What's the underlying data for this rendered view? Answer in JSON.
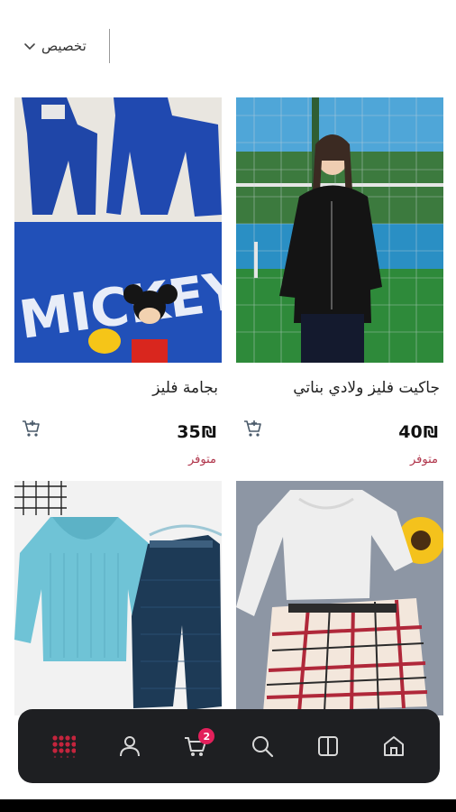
{
  "filter": {
    "label": "تخصيص"
  },
  "products": [
    {
      "title": "بجامة فليز",
      "price": "35",
      "currency": "₪",
      "stock": "متوفر",
      "image": "pajama-mickey-print"
    },
    {
      "title": "جاكيت فليز ولادي بناتي",
      "price": "40",
      "currency": "₪",
      "stock": "متوفر",
      "image": "girl-black-fleece-jacket"
    },
    {
      "title": "",
      "price": "",
      "currency": "",
      "stock": "",
      "image": "blue-sweater-and-pants-set"
    },
    {
      "title": "",
      "price": "",
      "currency": "",
      "stock": "",
      "image": "white-top-plaid-skirt-set"
    }
  ],
  "bottom_nav": {
    "items": [
      "grid-menu-icon",
      "user-icon",
      "cart-icon",
      "search-icon",
      "catalog-icon",
      "home-icon"
    ],
    "cart_badge": "2"
  },
  "colors": {
    "accent": "#e3205b",
    "stock_text": "#b0344a",
    "nav_bg": "#1e1f22",
    "menu_active": "#c4243d"
  }
}
